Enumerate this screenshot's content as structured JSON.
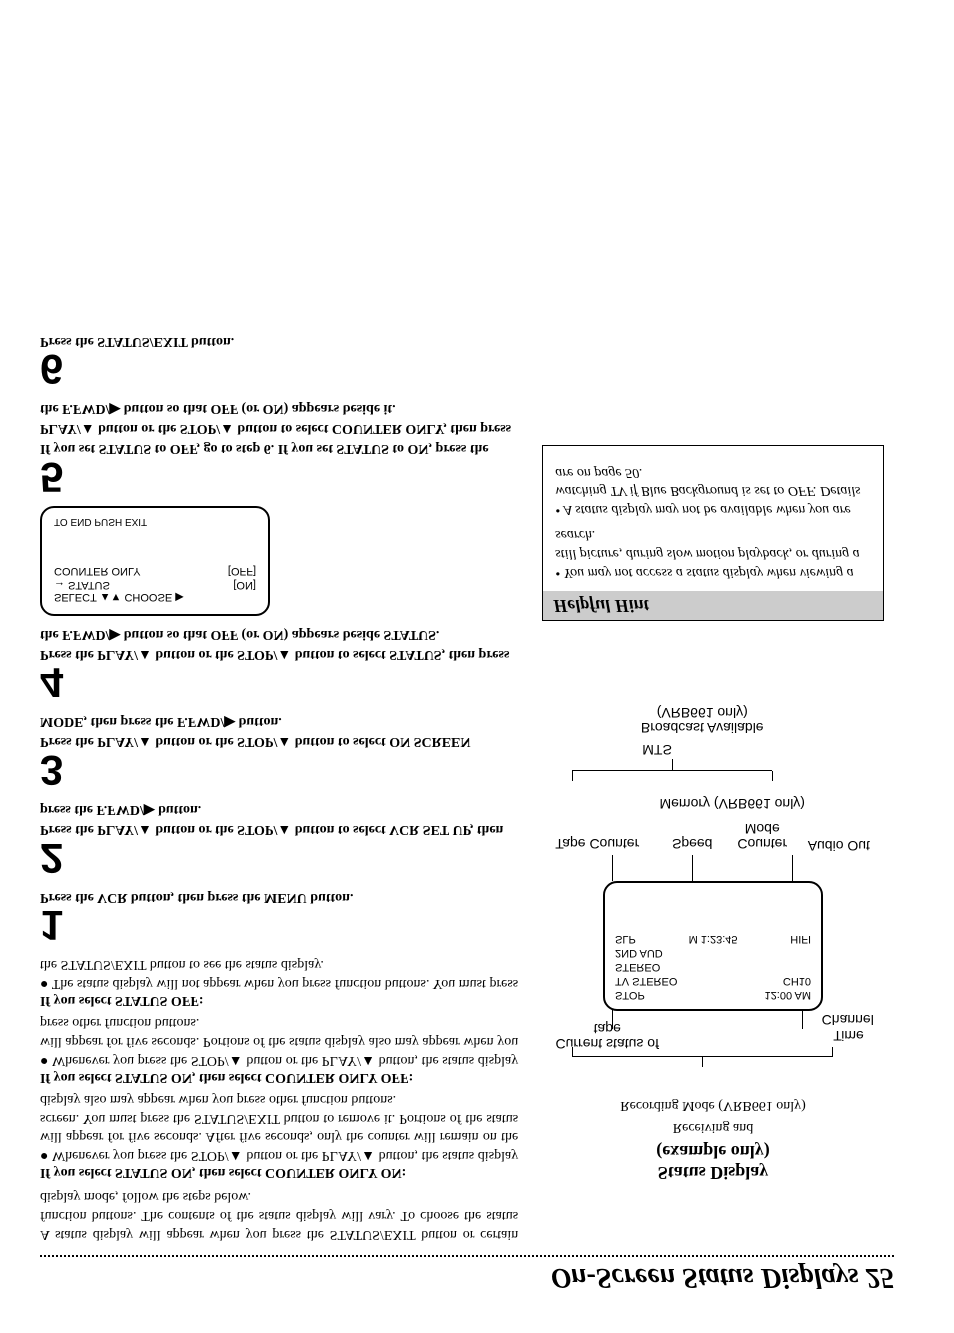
{
  "page": {
    "title": "On-Screen Status Displays 25"
  },
  "intro": "A status display will appear when you press the STATUS/EXIT button or certain function buttons. The contents of the status display will vary. To choose the status display mode, follow the steps below.",
  "modes": {
    "on": {
      "heading": "If you select STATUS ON, then select COUNTER ONLY ON:",
      "bullet": "Whenever you press the STOP/▲ button or the PLAY/▲ button, the status display will appear for five seconds. After five seconds, only the counter will remain on the screen. You must press the STATUS/EXIT button to remove it. Portions of the status display also may appear when you press other function buttons."
    },
    "off": {
      "heading": "If you select STATUS ON, then select COUNTER ONLY OFF:",
      "bullet": "Whenever you press the STOP/▲ button or the PLAY/▲ button, the status display will appear for five seconds. Portions of the status display also may appear when you press other function buttons."
    },
    "status_off": {
      "heading": "If you select STATUS OFF:",
      "bullet": "The status display will not appear when you press function buttons. You must press the STATUS/EXIT button to see the status display."
    }
  },
  "steps": [
    {
      "n": "1",
      "text": "Press the VCR button, then press the MENU button."
    },
    {
      "n": "2",
      "text": "Press the PLAY/▲ button or the STOP/▲ button to select VCR SET UP, then press the F.FWD/▶ button."
    },
    {
      "n": "3",
      "text": "Press the PLAY/▲ button or the STOP/▲ button to select ON SCREEN MODE, then press the F.FWD/▶ button."
    },
    {
      "n": "4",
      "text": "Press the PLAY/▲ button or the STOP/▲ button to select STATUS, then press the F.FWD/▶ button so that OFF (or ON) appears beside STATUS."
    },
    {
      "n": "5",
      "text": "If you set STATUS to OFF, go to step 6. If you set STATUS to ON, press the PLAY/▲ button or the STOP/▲ button to select COUNTER ONLY, then press the F.FWD/▶ button so that OFF (or ON) appears beside it."
    },
    {
      "n": "6",
      "text": "Press the STATUS/EXIT button."
    }
  ],
  "screen": {
    "select": "SELECT ▲▼ CHOOSE ▶",
    "row1a": "→ STATUS",
    "row1b": "[ON]",
    "row2a": "COUNTER ONLY",
    "row2b": "[OFF]",
    "end": "TO END PUSH EXIT"
  },
  "figure": {
    "title": "Status Display",
    "subtitle": "(example only)",
    "note": "Receiving and",
    "note2": "Recording Mode (VRB661 only)",
    "labels": {
      "current": "Current status of tape",
      "time": "Time",
      "channel": "Channel",
      "tape_counter": "Tape Counter",
      "speed": "Speed",
      "counter_mode": "Counter Mode",
      "memory": "Memory (VRB661 only)",
      "audio_out": "Audio Out",
      "mts": "MTS",
      "broadcast": "Broadcast Available (VRB661 only)"
    },
    "osd": {
      "r1a": "STOP",
      "r1b": "12:00 AM",
      "r2a": "TV STEREO",
      "r2b": "CH10",
      "r3": "STEREO",
      "r4": "2ND AUD",
      "r5a": "SLP",
      "r5b": "M  1:23:45",
      "r5c": "HIFI"
    }
  },
  "hint": {
    "header": "Helpful Hint",
    "b1": "You may not access a status display when viewing a still picture, during slow motion playback, or during a search.",
    "b2": "A status display may not be available when you are watching TV if Blue Background is set to OFF. Details are on page 50."
  }
}
